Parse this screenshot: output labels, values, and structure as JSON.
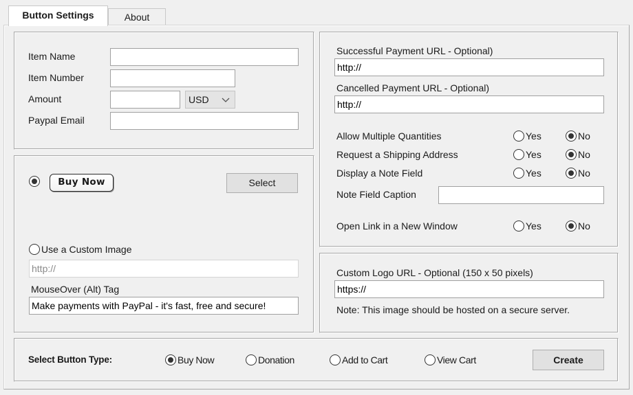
{
  "tabs": [
    {
      "label": "Button Settings",
      "active": true
    },
    {
      "label": "About",
      "active": false
    }
  ],
  "item_details": {
    "item_name": {
      "label": "Item Name",
      "value": ""
    },
    "item_number": {
      "label": "Item Number",
      "value": ""
    },
    "amount": {
      "label": "Amount",
      "value": ""
    },
    "currency": {
      "selected": "USD"
    },
    "paypal_email": {
      "label": "Paypal Email",
      "value": ""
    }
  },
  "button_image": {
    "standard_selected": true,
    "standard_button_text": "Buy Now",
    "select_label": "Select",
    "custom_image": {
      "label": "Use a Custom Image",
      "selected": false,
      "value": "http://"
    },
    "alt_tag": {
      "label": "MouseOver (Alt) Tag",
      "value": "Make payments with PayPal - it's fast, free and secure!"
    }
  },
  "urls": {
    "success": {
      "label": "Successful Payment URL - Optional)",
      "value": "http://"
    },
    "cancel": {
      "label": "Cancelled Payment URL - Optional)",
      "value": "http://"
    }
  },
  "options": {
    "yes_label": "Yes",
    "no_label": "No",
    "allow_multiple_quantities": {
      "label": "Allow Multiple Quantities",
      "value": "No"
    },
    "request_shipping_address": {
      "label": "Request a Shipping Address",
      "value": "No"
    },
    "display_note_field": {
      "label": "Display a Note Field",
      "value": "No"
    },
    "note_field_caption": {
      "label": "Note Field Caption",
      "value": ""
    },
    "open_new_window": {
      "label": "Open Link in a New Window",
      "value": "No"
    }
  },
  "logo": {
    "label": "Custom Logo URL - Optional (150 x 50 pixels)",
    "value": "https://",
    "note": "Note: This image should be hosted on a secure server."
  },
  "button_type": {
    "label": "Select Button Type:",
    "options": [
      "Buy Now",
      "Donation",
      "Add to Cart",
      "View Cart"
    ],
    "selected": "Buy Now",
    "create_label": "Create"
  }
}
